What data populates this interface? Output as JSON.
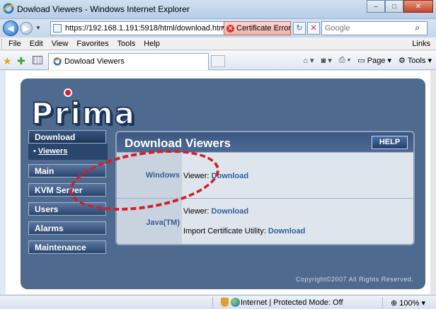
{
  "window": {
    "title": "Dowload Viewers - Windows Internet Explorer",
    "min": "–",
    "max": "□",
    "close": "✕"
  },
  "addressbar": {
    "url": "https://192.168.1.191:5918/html/download.html",
    "cert_error": "Certificate Error",
    "search_placeholder": "Google"
  },
  "menu": {
    "items": [
      "File",
      "Edit",
      "View",
      "Favorites",
      "Tools",
      "Help"
    ],
    "links": "Links"
  },
  "tabs": {
    "active": "Dowload Viewers"
  },
  "commands": {
    "page": "Page",
    "tools": "Tools"
  },
  "app": {
    "logo": "Prima",
    "nav": {
      "download": "Download",
      "viewers": "Viewers",
      "main": "Main",
      "kvm": "KVM Server",
      "users": "Users",
      "alarms": "Alarms",
      "maintenance": "Maintenance"
    },
    "panel": {
      "title": "Download Viewers",
      "help": "HELP",
      "rows": [
        {
          "label": "Windows",
          "viewer_prefix": "Viewer: ",
          "viewer_link": "Download"
        },
        {
          "label": "Java(TM)",
          "viewer_prefix": "Viewer: ",
          "viewer_link": "Download",
          "cert_prefix": "Import Certificate Utility: ",
          "cert_link": "Download"
        }
      ]
    },
    "copyright": "Copyright©2007  All Rights Reserved."
  },
  "statusbar": {
    "zone": "Internet | Protected Mode: Off",
    "zoom": "100%"
  }
}
